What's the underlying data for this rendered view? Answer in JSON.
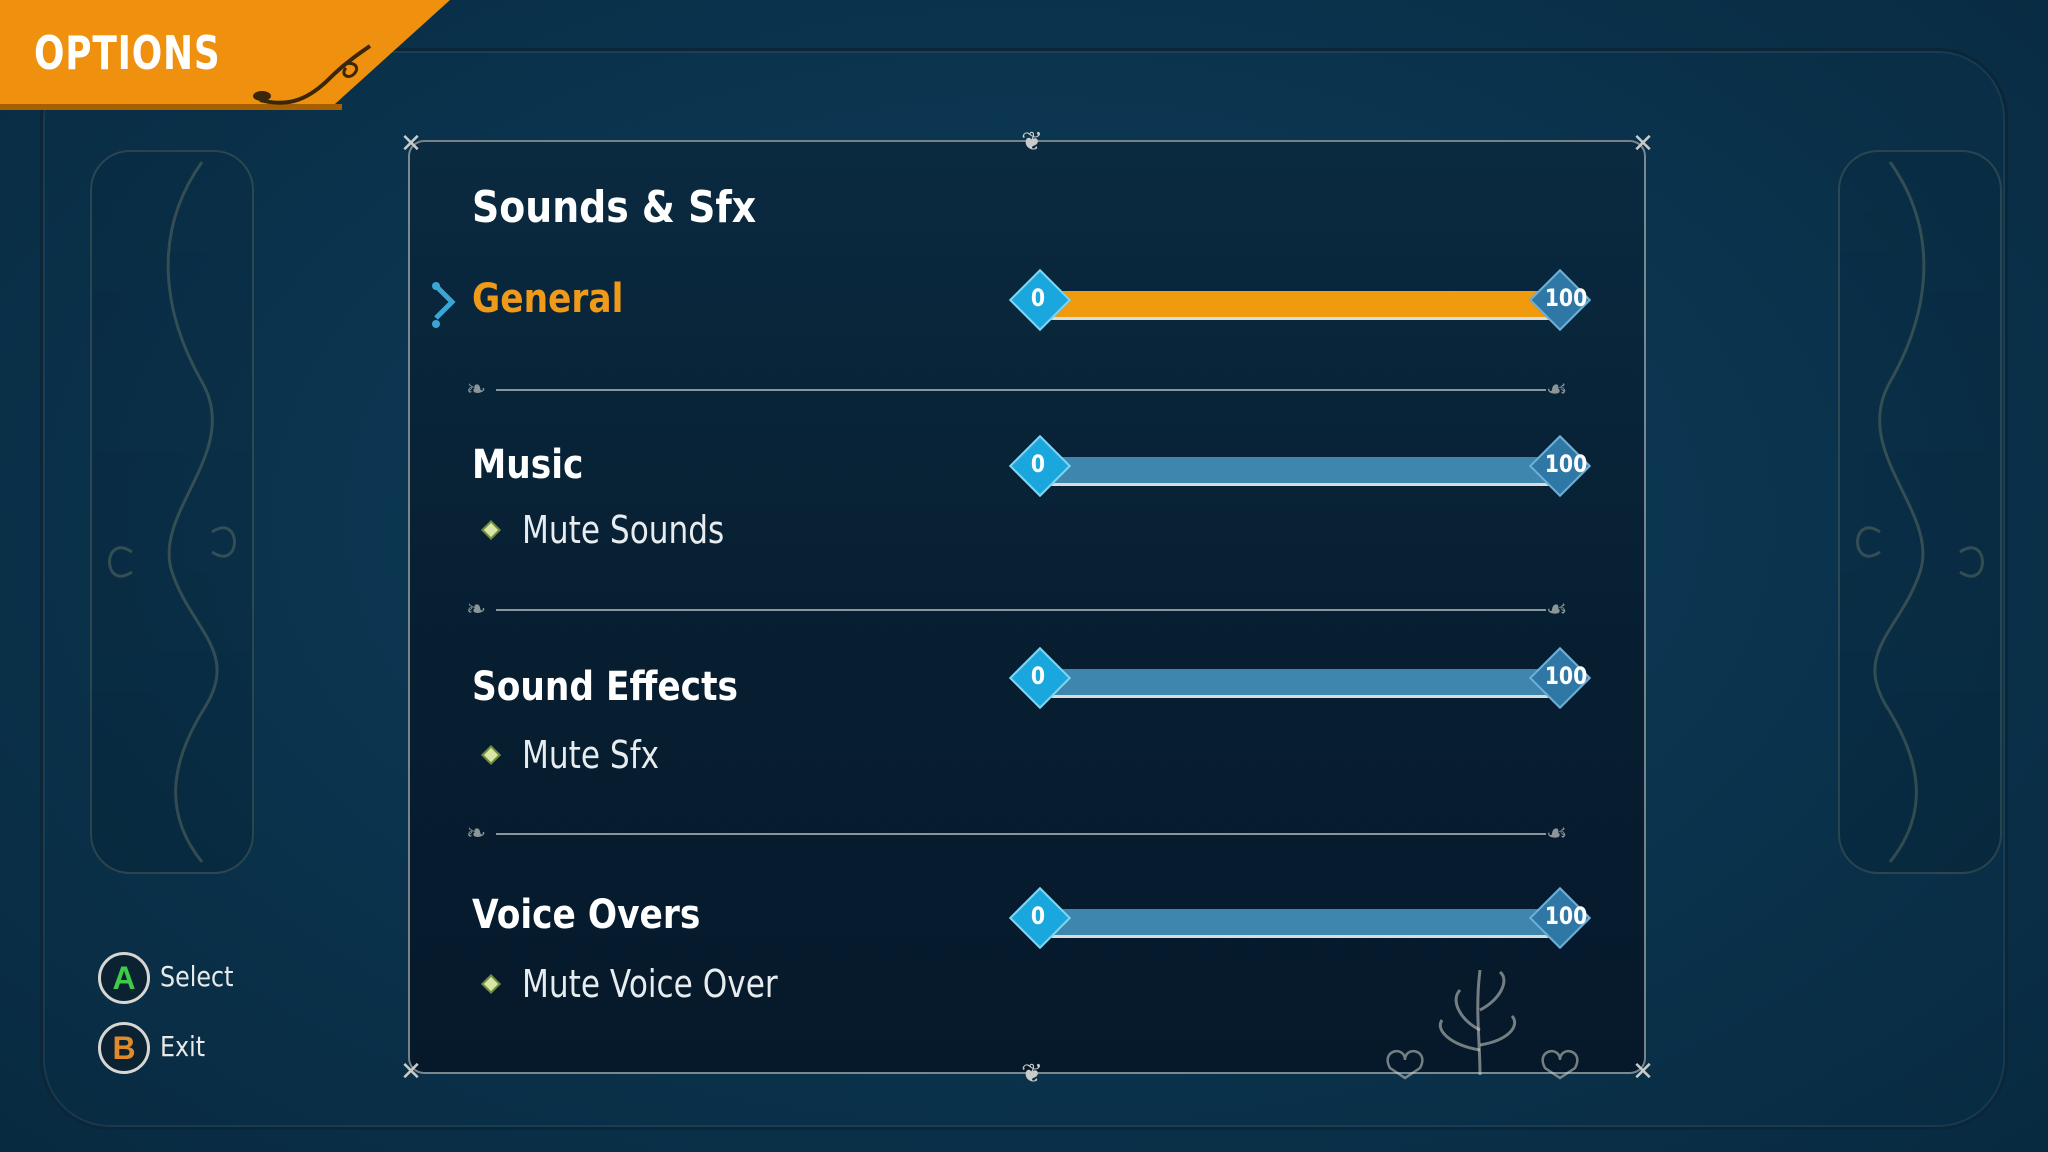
{
  "header": {
    "title": "OPTIONS"
  },
  "panel": {
    "heading": "Sounds & Sfx",
    "rows": [
      {
        "label": "General",
        "min_label": "0",
        "max_label": "100",
        "value": 100,
        "selected": true
      },
      {
        "label": "Music",
        "min_label": "0",
        "max_label": "100",
        "value": 100,
        "mute_label": "Mute Sounds"
      },
      {
        "label": "Sound Effects",
        "min_label": "0",
        "max_label": "100",
        "value": 100,
        "mute_label": "Mute Sfx"
      },
      {
        "label": "Voice Overs",
        "min_label": "0",
        "max_label": "100",
        "value": 100,
        "mute_label": "Mute Voice Over"
      }
    ]
  },
  "prompts": [
    {
      "button": "A",
      "label": "Select"
    },
    {
      "button": "B",
      "label": "Exit"
    }
  ],
  "colors": {
    "accent_orange": "#ef900e",
    "slider_blue": "#3e86ad",
    "knob_cyan": "#1aa7de",
    "background": "#0b3550"
  },
  "icons": [
    "selector-arrow-icon",
    "mute-diamond-icon",
    "a-button-icon",
    "b-button-icon",
    "leaf-ornament-icon"
  ]
}
